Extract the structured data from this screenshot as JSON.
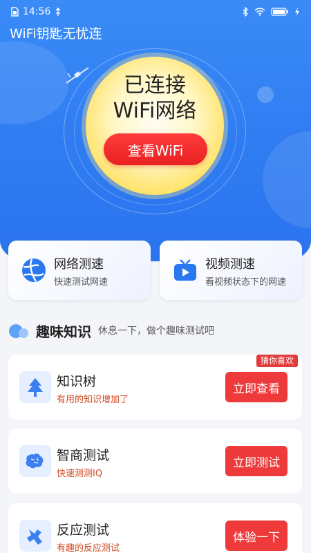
{
  "status": {
    "time": "14:56"
  },
  "app_title": "WiFi钥匙无忧连",
  "hero": {
    "line1": "已连接",
    "line2": "WiFi网络",
    "button": "查看WiFi"
  },
  "top_cards": [
    {
      "title": "网络测速",
      "subtitle": "快速测试网速",
      "icon": "globe-icon"
    },
    {
      "title": "视频测速",
      "subtitle": "看视频状态下的网速",
      "icon": "tv-play-icon"
    }
  ],
  "section": {
    "title": "趣味知识",
    "subtitle": "休息一下，做个趣味测试吧"
  },
  "badge": "猜你喜欢",
  "items": [
    {
      "title": "知识树",
      "subtitle": "有用的知识增加了",
      "button": "立即查看",
      "icon": "tree-icon"
    },
    {
      "title": "智商测试",
      "subtitle": "快速测测IQ",
      "button": "立即测试",
      "icon": "brain-icon"
    },
    {
      "title": "反应测试",
      "subtitle": "有趣的反应测试",
      "button": "体验一下",
      "icon": "reaction-icon"
    }
  ],
  "colors": {
    "hero_blue": "#2f7cf2",
    "accent_red": "#ee3a3a",
    "subtitle_orange": "#d1481f"
  }
}
